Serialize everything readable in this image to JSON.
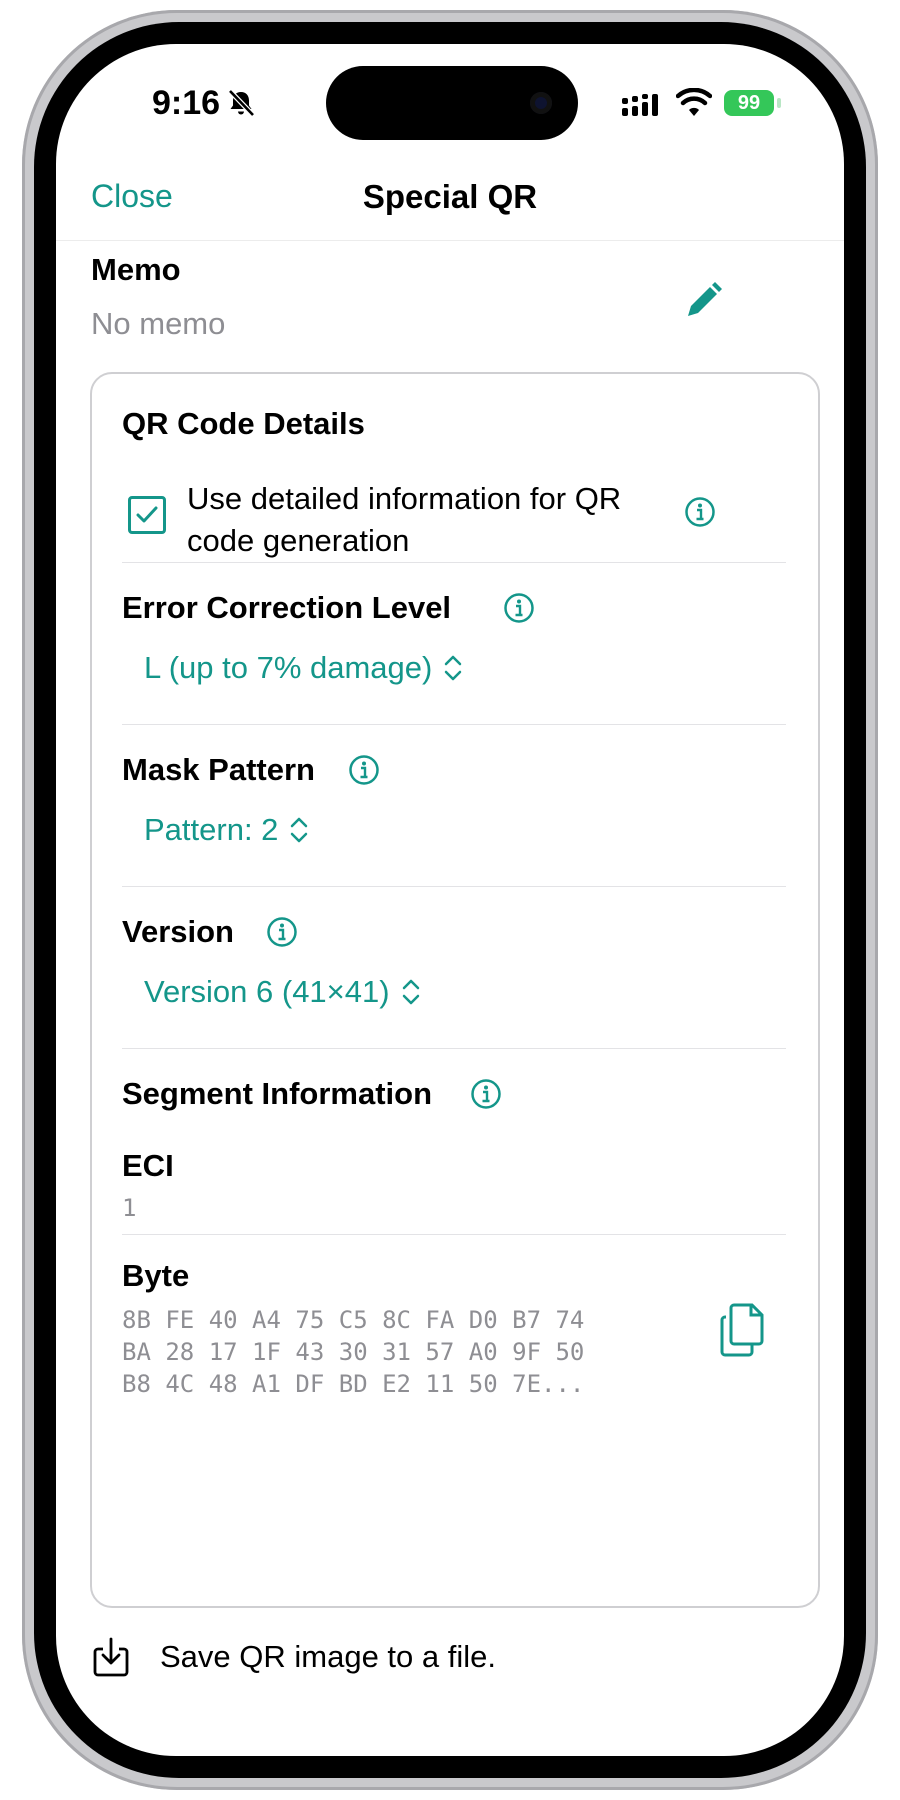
{
  "status_bar": {
    "time": "9:16",
    "battery": "99"
  },
  "nav": {
    "close_label": "Close",
    "title": "Special QR"
  },
  "memo": {
    "label": "Memo",
    "value": "No memo"
  },
  "details": {
    "title": "QR Code Details",
    "use_detailed_label": "Use detailed information for QR code generation",
    "use_detailed_checked": true,
    "error_correction": {
      "label": "Error Correction Level",
      "value": "L (up to 7% damage)"
    },
    "mask_pattern": {
      "label": "Mask Pattern",
      "value": "Pattern: 2"
    },
    "version": {
      "label": "Version",
      "value": "Version 6 (41×41)"
    },
    "segment": {
      "label": "Segment Information",
      "eci_label": "ECI",
      "eci_value": "1",
      "byte_label": "Byte",
      "byte_lines": [
        "8B FE 40 A4 75 C5 8C FA D0 B7 74",
        "BA 28 17 1F 43 30 31 57 A0 9F 50",
        "B8 4C 48 A1 DF BD E2 11 50 7E..."
      ]
    }
  },
  "save": {
    "label": "Save QR image to a file."
  },
  "colors": {
    "accent": "#14968a",
    "secondary_text": "#8e8e93",
    "battery": "#34c759"
  },
  "icons": [
    "bell-slash-icon",
    "cellular-signal-icon",
    "wifi-icon",
    "battery-icon",
    "pencil-icon",
    "info-icon",
    "chevron-up-down-icon",
    "copy-icon",
    "download-icon",
    "checkmark-icon"
  ]
}
